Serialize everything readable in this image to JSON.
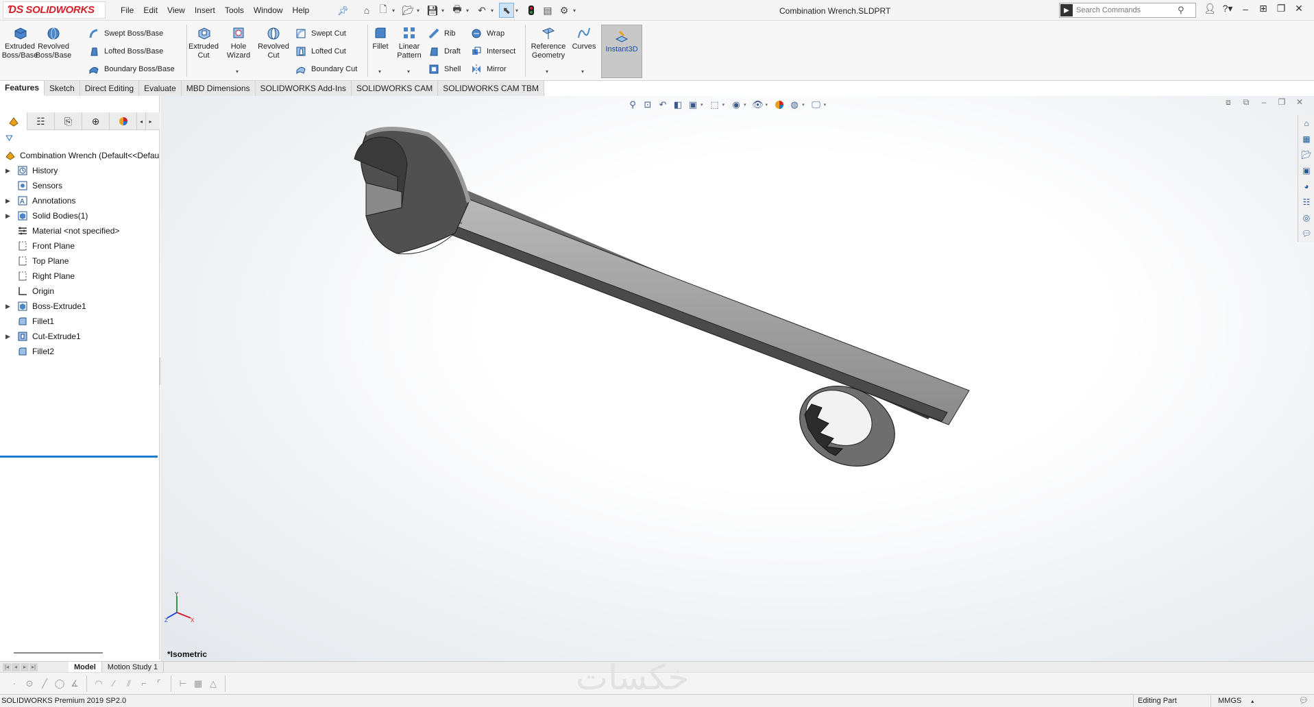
{
  "app": {
    "brand": "SOLIDWORKS",
    "document_title": "Combination Wrench.SLDPRT",
    "menu": [
      "File",
      "Edit",
      "View",
      "Insert",
      "Tools",
      "Window",
      "Help"
    ],
    "search_placeholder": "Search Commands"
  },
  "ribbon": {
    "extruded_boss": "Extruded Boss/Base",
    "revolved_boss": "Revolved Boss/Base",
    "swept_boss": "Swept Boss/Base",
    "lofted_boss": "Lofted Boss/Base",
    "boundary_boss": "Boundary Boss/Base",
    "extruded_cut": "Extruded Cut",
    "hole_wizard": "Hole Wizard",
    "revolved_cut": "Revolved Cut",
    "swept_cut": "Swept Cut",
    "lofted_cut": "Lofted Cut",
    "boundary_cut": "Boundary Cut",
    "fillet": "Fillet",
    "linear_pattern": "Linear Pattern",
    "rib": "Rib",
    "draft": "Draft",
    "shell": "Shell",
    "wrap": "Wrap",
    "intersect": "Intersect",
    "mirror": "Mirror",
    "reference_geometry": "Reference Geometry",
    "curves": "Curves",
    "instant3d": "Instant3D"
  },
  "tabs": [
    "Features",
    "Sketch",
    "Direct Editing",
    "Evaluate",
    "MBD Dimensions",
    "SOLIDWORKS Add-Ins",
    "SOLIDWORKS CAM",
    "SOLIDWORKS CAM TBM"
  ],
  "tree": {
    "root": "Combination Wrench  (Default<<Defau",
    "items": [
      {
        "label": "History",
        "icon": "history-icon",
        "expandable": true
      },
      {
        "label": "Sensors",
        "icon": "sensors-icon",
        "expandable": false
      },
      {
        "label": "Annotations",
        "icon": "annotations-icon",
        "expandable": true
      },
      {
        "label": "Solid Bodies(1)",
        "icon": "solid-bodies-icon",
        "expandable": true
      },
      {
        "label": "Material <not specified>",
        "icon": "material-icon",
        "expandable": false
      },
      {
        "label": "Front Plane",
        "icon": "plane-icon",
        "expandable": false
      },
      {
        "label": "Top Plane",
        "icon": "plane-icon",
        "expandable": false
      },
      {
        "label": "Right Plane",
        "icon": "plane-icon",
        "expandable": false
      },
      {
        "label": "Origin",
        "icon": "origin-icon",
        "expandable": false
      },
      {
        "label": "Boss-Extrude1",
        "icon": "boss-extrude-icon",
        "expandable": true
      },
      {
        "label": "Fillet1",
        "icon": "fillet-icon",
        "expandable": false
      },
      {
        "label": "Cut-Extrude1",
        "icon": "cut-extrude-icon",
        "expandable": true
      },
      {
        "label": "Fillet2",
        "icon": "fillet-icon",
        "expandable": false
      }
    ]
  },
  "viewport": {
    "view_label": "*Isometric"
  },
  "bottom_tabs": [
    "Model",
    "Motion Study 1"
  ],
  "status": {
    "product": "SOLIDWORKS Premium 2019 SP2.0",
    "mode": "Editing Part",
    "units": "MMGS"
  },
  "watermark": "خكسات",
  "colors": {
    "brand_red": "#d4202a",
    "accent_blue": "#1f7bd1",
    "model_gray": "#8c8c8c"
  }
}
